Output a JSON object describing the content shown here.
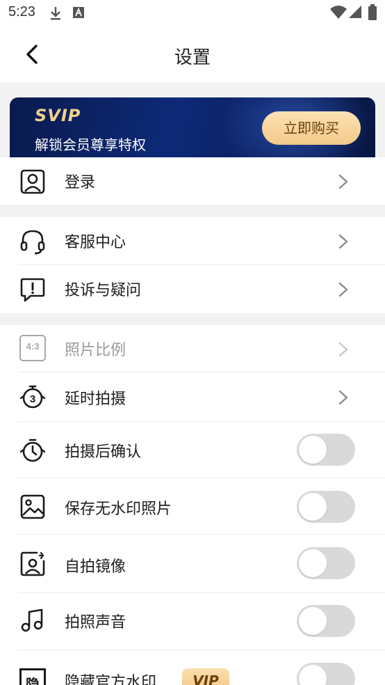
{
  "status_bar": {
    "time": "5:23",
    "icons": [
      "download-icon",
      "text-a-icon",
      "wifi-icon",
      "cellular-icon",
      "battery-icon"
    ]
  },
  "header": {
    "title": "设置",
    "back_icon": "chevron-left-icon"
  },
  "vip_banner": {
    "badge": "SVIP",
    "subtitle": "解锁会员尊享特权",
    "buy_label": "立即购买"
  },
  "account": {
    "login_label": "登录"
  },
  "support": {
    "items": [
      {
        "label": "客服中心",
        "icon": "headset-icon"
      },
      {
        "label": "投诉与疑问",
        "icon": "alert-bubble-icon"
      }
    ]
  },
  "camera_settings": {
    "photo_ratio": {
      "label": "照片比例",
      "icon_text": "4:3",
      "disabled": true
    },
    "timer": {
      "label": "延时拍摄",
      "icon_text": "3"
    },
    "confirm_after": {
      "label": "拍摄后确认",
      "on": false
    },
    "save_no_watermark": {
      "label": "保存无水印照片",
      "on": false
    },
    "selfie_mirror": {
      "label": "自拍镜像",
      "on": false
    },
    "shutter_sound": {
      "label": "拍照声音",
      "on": false
    },
    "hide_watermark": {
      "label": "隐藏官方水印",
      "icon_text": "隐",
      "tag": "VIP",
      "on": false
    }
  },
  "colors": {
    "vip_gold": "#f2d08f",
    "banner_navy": "#0d2a78",
    "toggle_off": "#d9d9d9"
  }
}
